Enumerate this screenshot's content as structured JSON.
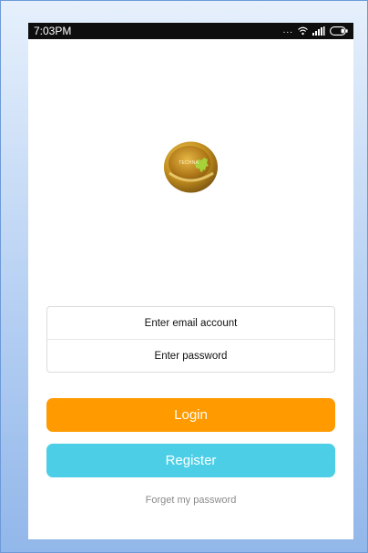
{
  "status_bar": {
    "time": "7:03PM",
    "signal_dots": "...",
    "icons": [
      "more-dots-icon",
      "wifi-icon",
      "signal-icon",
      "battery-icon"
    ]
  },
  "logo": {
    "text": "TECHNA",
    "icon": "lion-icon"
  },
  "form": {
    "email_placeholder": "Enter email account",
    "email_value": "",
    "password_placeholder": "Enter password",
    "password_value": ""
  },
  "buttons": {
    "login_label": "Login",
    "register_label": "Register"
  },
  "links": {
    "forget_password": "Forget my password"
  },
  "colors": {
    "login": "#ff9a00",
    "register": "#4ccfe6",
    "status_bar": "#0e0e0e",
    "background": "#ffffff"
  }
}
